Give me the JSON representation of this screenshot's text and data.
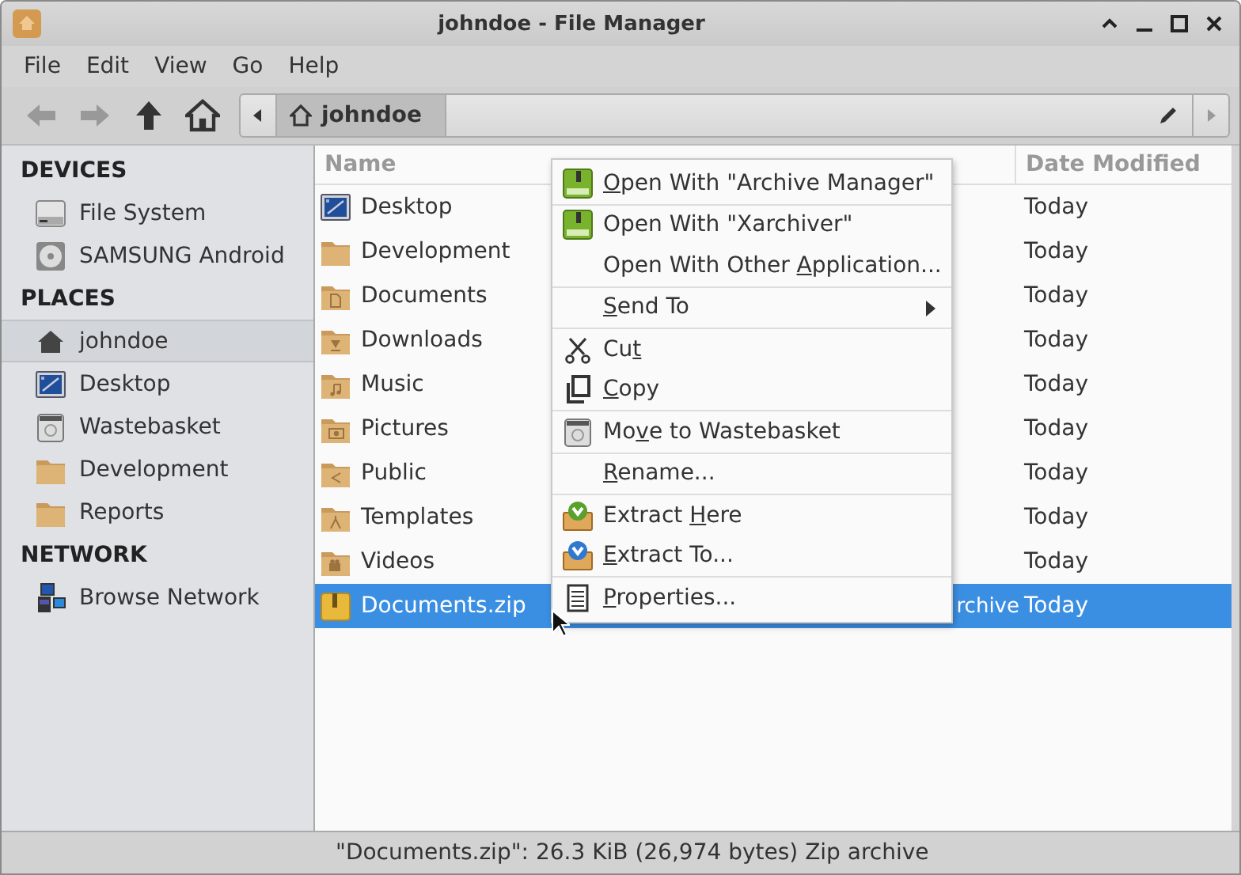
{
  "window": {
    "title": "johndoe - File Manager"
  },
  "menubar": [
    "File",
    "Edit",
    "View",
    "Go",
    "Help"
  ],
  "toolbar": {
    "back_disabled": true,
    "forward_disabled": true,
    "path": [
      {
        "label": "johndoe",
        "selected": true
      }
    ]
  },
  "sidebar": {
    "sections": [
      {
        "heading": "DEVICES",
        "items": [
          {
            "label": "File System",
            "kind": "drive",
            "selected": false
          },
          {
            "label": "SAMSUNG Android",
            "kind": "disc",
            "selected": false
          }
        ]
      },
      {
        "heading": "PLACES",
        "items": [
          {
            "label": "johndoe",
            "kind": "home",
            "selected": true
          },
          {
            "label": "Desktop",
            "kind": "desktop",
            "selected": false
          },
          {
            "label": "Wastebasket",
            "kind": "trash",
            "selected": false
          },
          {
            "label": "Development",
            "kind": "folder",
            "selected": false
          },
          {
            "label": "Reports",
            "kind": "folder",
            "selected": false
          }
        ]
      },
      {
        "heading": "NETWORK",
        "items": [
          {
            "label": "Browse Network",
            "kind": "network",
            "selected": false
          }
        ]
      }
    ]
  },
  "table": {
    "columns": [
      {
        "label": "Name"
      },
      {
        "label": "Date Modified"
      }
    ],
    "rows": [
      {
        "name": "Desktop",
        "kind": "desktop",
        "date": "Today",
        "selected": false
      },
      {
        "name": "Development",
        "kind": "folder",
        "date": "Today",
        "selected": false
      },
      {
        "name": "Documents",
        "kind": "documents",
        "date": "Today",
        "selected": false
      },
      {
        "name": "Downloads",
        "kind": "downloads",
        "date": "Today",
        "selected": false
      },
      {
        "name": "Music",
        "kind": "music",
        "date": "Today",
        "selected": false
      },
      {
        "name": "Pictures",
        "kind": "pictures",
        "date": "Today",
        "selected": false
      },
      {
        "name": "Public",
        "kind": "public",
        "date": "Today",
        "selected": false
      },
      {
        "name": "Templates",
        "kind": "templates",
        "date": "Today",
        "selected": false
      },
      {
        "name": "Videos",
        "kind": "videos",
        "date": "Today",
        "selected": false
      },
      {
        "name": "Documents.zip",
        "kind": "zip",
        "type": "rchive",
        "date": "Today",
        "selected": true
      }
    ]
  },
  "context_menu": {
    "groups": [
      [
        {
          "key": "O",
          "after": "pen With \"Archive Manager\"",
          "kind": "archive"
        }
      ],
      [
        {
          "before": "Open With \"Xarchiver\"",
          "kind": "archive"
        },
        {
          "before": "Open With Other ",
          "key": "A",
          "after": "pplication...",
          "kind": "plain"
        }
      ],
      [
        {
          "key": "S",
          "after": "end To",
          "kind": "plain",
          "submenu": true
        }
      ],
      [
        {
          "before": "Cu",
          "key": "t",
          "kind": "cut"
        },
        {
          "key": "C",
          "after": "opy",
          "kind": "copy"
        }
      ],
      [
        {
          "before": "Mo",
          "key": "v",
          "after": "e to Wastebasket",
          "kind": "trash"
        }
      ],
      [
        {
          "key": "R",
          "after": "ename...",
          "kind": "plain"
        }
      ],
      [
        {
          "before": "Extract ",
          "key": "H",
          "after": "ere",
          "kind": "extract-here"
        },
        {
          "key": "E",
          "after": "xtract To...",
          "kind": "extract-to"
        }
      ],
      [
        {
          "key": "P",
          "after": "roperties...",
          "kind": "properties"
        }
      ]
    ]
  },
  "status_bar": "\"Documents.zip\": 26.3 KiB (26,974 bytes) Zip archive"
}
